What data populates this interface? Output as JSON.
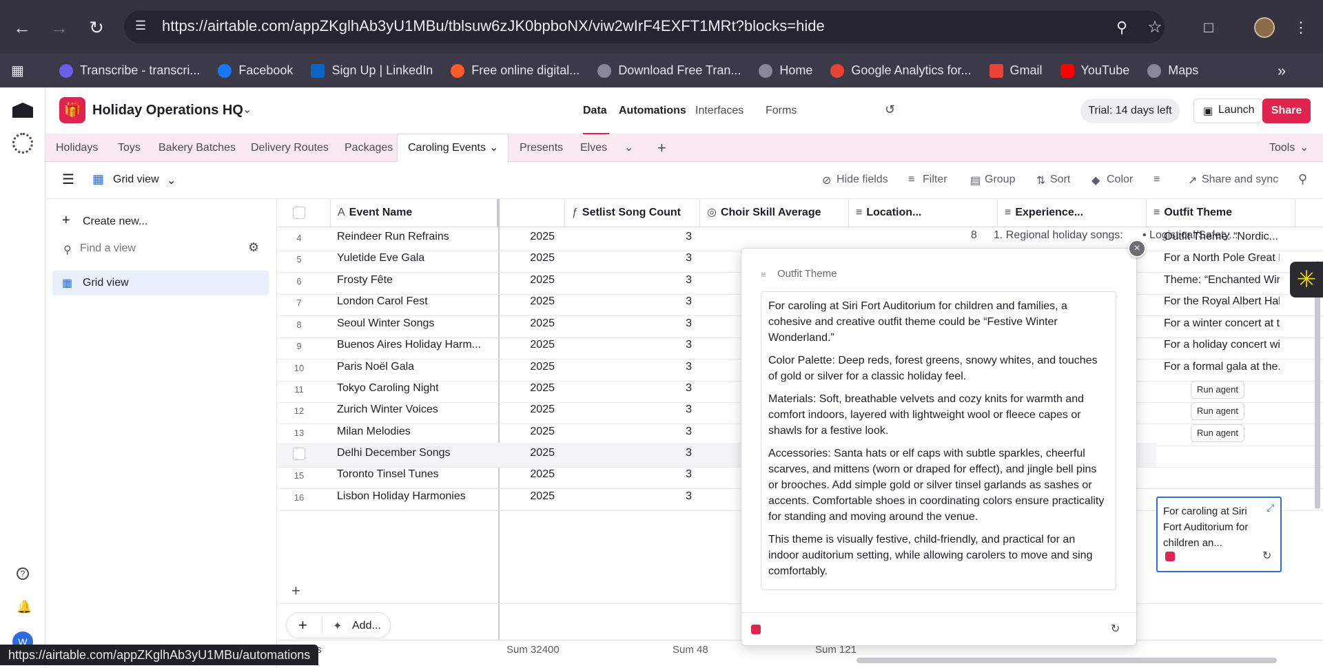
{
  "browser": {
    "url": "https://airtable.com/appZKglhAb3yU1MBu/tblsuw6zJK0bpboNX/viw2wIrF4EXFT1MRt?blocks=hide",
    "bookmarks": [
      {
        "label": "Transcribe - transcri...",
        "icon": "transcribe-icon",
        "color": "#6c5ce7"
      },
      {
        "label": "Facebook",
        "icon": "facebook-icon",
        "color": "#1877f2"
      },
      {
        "label": "Sign Up | LinkedIn",
        "icon": "linkedin-icon",
        "color": "#0a66c2"
      },
      {
        "label": "Free online digital...",
        "icon": "swirl-icon",
        "color": "#ff5a2a"
      },
      {
        "label": "Download Free Tran...",
        "icon": "globe-icon",
        "color": "#8a8896"
      },
      {
        "label": "Home",
        "icon": "globe-icon",
        "color": "#8a8896"
      },
      {
        "label": "Google Analytics for...",
        "icon": "google-icon",
        "color": "#ea4335"
      },
      {
        "label": "Gmail",
        "icon": "gmail-icon",
        "color": "#ea4335"
      },
      {
        "label": "YouTube",
        "icon": "youtube-icon",
        "color": "#ff0000"
      },
      {
        "label": "Maps",
        "icon": "globe-icon",
        "color": "#8a8896"
      }
    ]
  },
  "app": {
    "base_name": "Holiday Operations HQ",
    "brand_color": "#e0244f",
    "nav": [
      "Data",
      "Automations",
      "Interfaces",
      "Forms"
    ],
    "trial": "Trial: 14 days left",
    "launch": "Launch",
    "share": "Share"
  },
  "tables": {
    "items": [
      "Holidays",
      "Toys",
      "Bakery Batches",
      "Delivery Routes",
      "Packages",
      "Caroling Events",
      "Presents",
      "Elves"
    ],
    "active": "Caroling Events",
    "tools": "Tools"
  },
  "viewbar": {
    "view_name": "Grid view",
    "hide_fields": "Hide fields",
    "filter": "Filter",
    "group": "Group",
    "sort": "Sort",
    "color": "Color",
    "share_sync": "Share and sync"
  },
  "sidebar": {
    "create_new": "Create new...",
    "find_placeholder": "Find a view",
    "views": [
      "Grid view"
    ]
  },
  "grid": {
    "columns": [
      "Event Name",
      "Setlist Song Count",
      "Choir Skill Average",
      "Location...",
      "Experience...",
      "Outfit Theme"
    ],
    "partial_row": {
      "skill": "8",
      "location": "1. Regional holiday songs:",
      "experience": "• Logistical/Safety..."
    },
    "rows": [
      {
        "num": "4",
        "name": "Reindeer Run Refrains",
        "year": "2025",
        "count": "3",
        "outfit": "Outfit Theme: “Nordic..."
      },
      {
        "num": "5",
        "name": "Yuletide Eve Gala",
        "year": "2025",
        "count": "3",
        "outfit": "For a North Pole Great Hal"
      },
      {
        "num": "6",
        "name": "Frosty Fête",
        "year": "2025",
        "count": "3",
        "outfit": "Theme: “Enchanted Winter..."
      },
      {
        "num": "7",
        "name": "London Carol Fest",
        "year": "2025",
        "count": "3",
        "outfit": "For the Royal Albert Hall's..."
      },
      {
        "num": "8",
        "name": "Seoul Winter Songs",
        "year": "2025",
        "count": "3",
        "outfit": "For a winter concert at the..."
      },
      {
        "num": "9",
        "name": "Buenos Aires Holiday Harm...",
        "year": "2025",
        "count": "3",
        "outfit": "For a holiday concert with..."
      },
      {
        "num": "10",
        "name": "Paris Noël Gala",
        "year": "2025",
        "count": "3",
        "outfit": "For a formal gala at the..."
      },
      {
        "num": "11",
        "name": "Tokyo Caroling Night",
        "year": "2025",
        "count": "3",
        "outfit": "Run agent"
      },
      {
        "num": "12",
        "name": "Zurich Winter Voices",
        "year": "2025",
        "count": "3",
        "outfit": "Run agent"
      },
      {
        "num": "13",
        "name": "Milan Melodies",
        "year": "2025",
        "count": "3",
        "outfit": "Run agent"
      },
      {
        "num": "",
        "name": "Delhi December Songs",
        "year": "2025",
        "count": "3",
        "outfit": ""
      },
      {
        "num": "15",
        "name": "Toronto Tinsel Tunes",
        "year": "2025",
        "count": "3",
        "outfit": ""
      },
      {
        "num": "16",
        "name": "Lisbon Holiday Harmonies",
        "year": "2025",
        "count": "3",
        "outfit": ""
      }
    ],
    "selected_cell_text": "For caroling at Siri Fort Auditorium for children an...",
    "add_label": "Add...",
    "sums": {
      "c1": "Sum 32400",
      "c2": "Sum 48",
      "c3": "Sum 121",
      "records": "ds"
    }
  },
  "popup": {
    "title": "Outfit Theme",
    "paragraphs": [
      "For caroling at Siri Fort Auditorium for children and families, a cohesive and creative outfit theme could be “Festive Winter Wonderland.”",
      "Color Palette: Deep reds, forest greens, snowy whites, and touches of gold or silver for a classic holiday feel.",
      "Materials: Soft, breathable velvets and cozy knits for warmth and comfort indoors, layered with lightweight wool or fleece capes or shawls for a festive look.",
      "Accessories: Santa hats or elf caps with subtle sparkles, cheerful scarves, and mittens (worn or draped for effect), and jingle bell pins or brooches. Add simple gold or silver tinsel garlands as sashes or accents. Comfortable shoes in coordinating colors ensure practicality for standing and moving around the venue.",
      "This theme is visually festive, child-friendly, and practical for an indoor auditorium setting, while allowing carolers to move and sing comfortably."
    ]
  },
  "status_url": "https://airtable.com/appZKglhAb3yU1MBu/automations"
}
